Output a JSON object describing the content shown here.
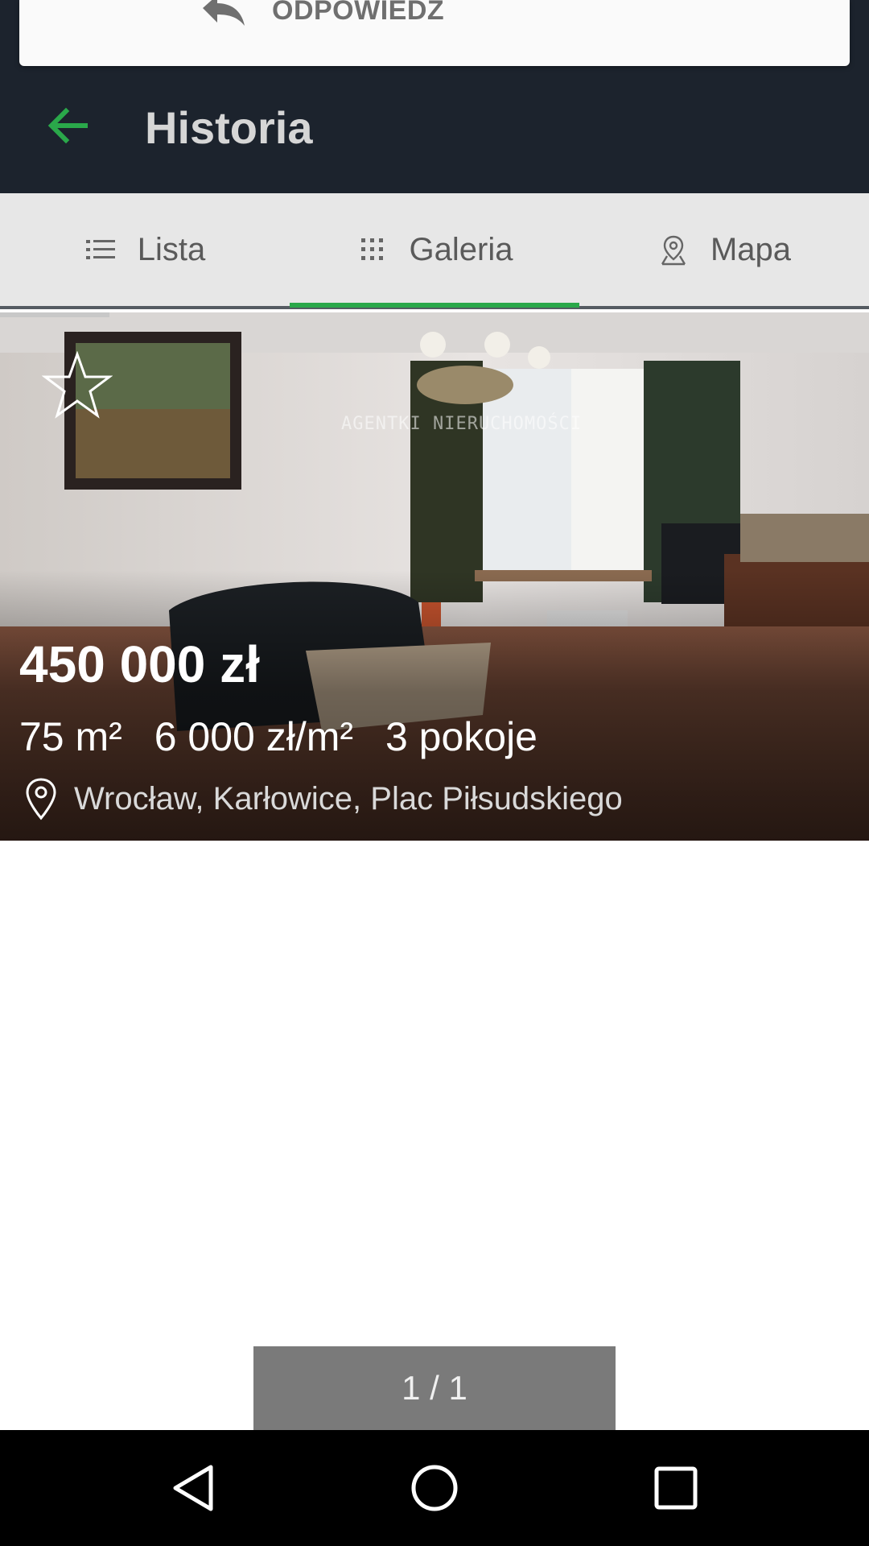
{
  "snackbar": {
    "action_label": "ODPOWIEDZ",
    "icon": "reply-icon"
  },
  "appbar": {
    "title": "Historia",
    "back_icon": "back-arrow-icon",
    "accent_color": "#2aa84a"
  },
  "tabs": [
    {
      "label": "Lista",
      "icon": "list-icon",
      "selected": false
    },
    {
      "label": "Galeria",
      "icon": "grid-icon",
      "selected": true
    },
    {
      "label": "Mapa",
      "icon": "map-pin-icon",
      "selected": false
    }
  ],
  "listing": {
    "favorite_icon": "star-outline-icon",
    "watermark": "AGENTKI NIERUCHOMOŚCI",
    "price": "450 000 zł",
    "area": "75 m²",
    "price_per_m2": "6 000 zł/m²",
    "rooms": "3 pokoje",
    "location": "Wrocław, Karłowice, Plac Piłsudskiego",
    "location_icon": "location-pin-icon"
  },
  "pager": {
    "text": "1 / 1"
  },
  "system_nav": {
    "back": "nav-back-icon",
    "home": "nav-home-icon",
    "recents": "nav-recents-icon"
  }
}
